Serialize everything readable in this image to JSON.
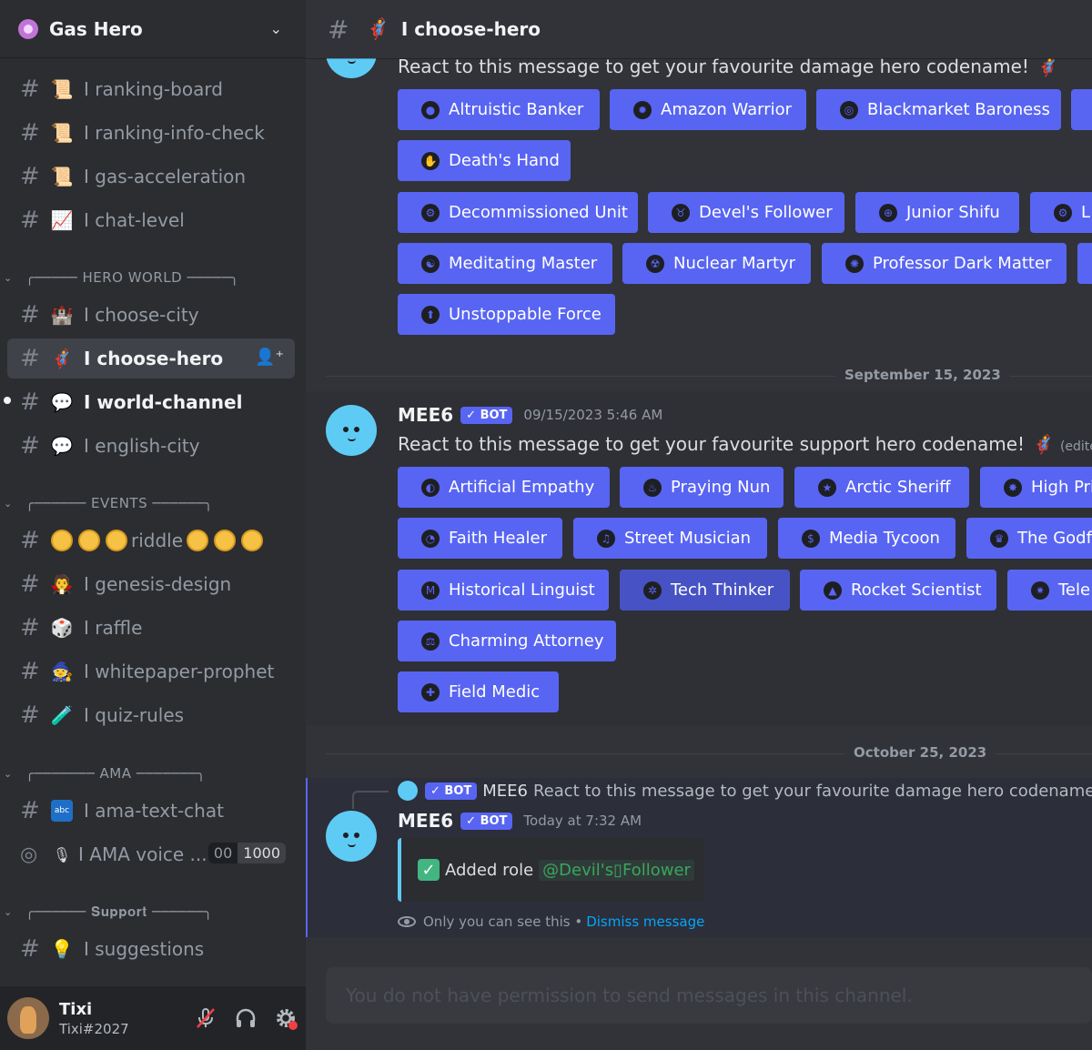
{
  "server": {
    "name": "Gas Hero"
  },
  "sidebar": {
    "channels_top": [
      {
        "label": "ranking-board",
        "icon": "scroll-emoji"
      },
      {
        "label": "ranking-info-check",
        "icon": "scroll-emoji"
      },
      {
        "label": "gas-acceleration",
        "icon": "scroll-emoji"
      },
      {
        "label": "chat-level",
        "icon": "chart-emoji"
      }
    ],
    "cat_hero": "╭───── HERO WORLD ─────╮",
    "hero_channels": [
      {
        "label": "choose-city",
        "icon": "castle-emoji"
      },
      {
        "label": "choose-hero",
        "icon": "hero-emoji"
      },
      {
        "label": "world-channel",
        "icon": "speech-emoji"
      },
      {
        "label": "english-city",
        "icon": "speech-emoji"
      }
    ],
    "cat_events": "╭────── EVENTS ──────╮",
    "riddle": "riddle",
    "event_channels": [
      {
        "label": "genesis-design",
        "icon": "vampire-emoji"
      },
      {
        "label": "raffle",
        "icon": "dice-emoji"
      },
      {
        "label": "whitepaper-prophet",
        "icon": "wizard-emoji"
      },
      {
        "label": "quiz-rules",
        "icon": "test-tube-emoji"
      }
    ],
    "cat_ama": "╭─────── AMA ───────╮",
    "ama_text": "ama-text-chat",
    "ama_voice": "AMA voice ...",
    "voice_count_a": "00",
    "voice_count_b": "1000",
    "cat_support": "╭────── 𝐒𝐮𝐩𝐩𝐨𝐫𝐭 ──────╮",
    "suggestions": "suggestions",
    "sep": "I"
  },
  "user": {
    "name": "Tixi",
    "tag": "Tixi#2027"
  },
  "header": {
    "title": "I choose-hero"
  },
  "messages": {
    "top_text": "React to this message to get your favourite damage hero codename!",
    "damage_buttons": [
      "Altruistic Banker",
      "Amazon Warrior",
      "Blackmarket Baroness",
      "Death's Hand",
      "Decommissioned Unit",
      "Devel's Follower",
      "Junior Shifu",
      "L",
      "Meditating Master",
      "Nuclear Martyr",
      "Professor Dark Matter",
      "Unstoppable Force"
    ],
    "date1": "September 15, 2023",
    "author": "MEE6",
    "bot": "✓ BOT",
    "ts1": "09/15/2023 5:46 AM",
    "support_text": "React to this message to get your favourite support hero codename!",
    "edited": "(edited)",
    "support_buttons": [
      "Artificial Empathy",
      "Praying Nun",
      "Arctic Sheriff",
      "High Pri",
      "Faith Healer",
      "Street Musician",
      "Media Tycoon",
      "The Godfa",
      "Historical Linguist",
      "Tech Thinker",
      "Rocket Scientist",
      "Tele",
      "Charming Attorney",
      "Field Medic"
    ],
    "date2": "October 25, 2023",
    "reply_preview": "React to this message to get your favourite damage hero codename!",
    "ts2": "Today at 7:32 AM",
    "added_role": "Added role",
    "role_mention": "@Devil's▯Follower",
    "only_you": "Only you can see this •",
    "dismiss": "Dismiss message"
  },
  "composer": {
    "placeholder": "You do not have permission to send messages in this channel."
  },
  "colors": {
    "blurple": "#5865f2",
    "bg": "#313338",
    "sidebar": "#2b2d31"
  }
}
